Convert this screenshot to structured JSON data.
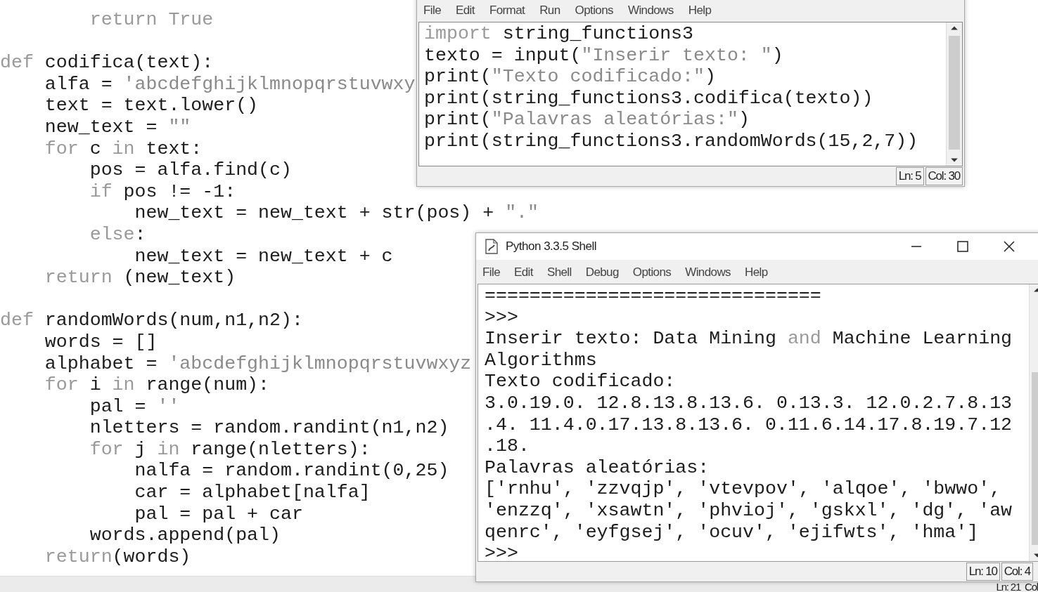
{
  "background_editor": {
    "functions": [
      {
        "lines": [
          [
            {
              "text": "        return True",
              "kind": "keyword"
            }
          ]
        ]
      },
      {
        "lines": [
          [
            {
              "text": "def",
              "kind": "keyword"
            },
            {
              "text": " codifica(text):",
              "kind": "plain"
            }
          ],
          [
            {
              "text": "    alfa = ",
              "kind": "plain"
            },
            {
              "text": "'abcdefghijklmnopqrstuvwxy",
              "kind": "string"
            }
          ],
          [
            {
              "text": "    text = text.lower()",
              "kind": "plain"
            }
          ],
          [
            {
              "text": "    new_text = ",
              "kind": "plain"
            },
            {
              "text": "\"\"",
              "kind": "string"
            }
          ],
          [
            {
              "text": "    for",
              "kind": "keyword"
            },
            {
              "text": " c ",
              "kind": "plain"
            },
            {
              "text": "in",
              "kind": "keyword"
            },
            {
              "text": " text:",
              "kind": "plain"
            }
          ],
          [
            {
              "text": "        pos = alfa.find(c)",
              "kind": "plain"
            }
          ],
          [
            {
              "text": "        if",
              "kind": "keyword"
            },
            {
              "text": " pos != -1:",
              "kind": "plain"
            }
          ],
          [
            {
              "text": "            new_text = new_text + str(pos) + ",
              "kind": "plain"
            },
            {
              "text": "\".\"",
              "kind": "string"
            }
          ],
          [
            {
              "text": "        else",
              "kind": "keyword"
            },
            {
              "text": ":",
              "kind": "plain"
            }
          ],
          [
            {
              "text": "            new_text = new_text + c",
              "kind": "plain"
            }
          ],
          [
            {
              "text": "    return",
              "kind": "keyword"
            },
            {
              "text": " (new_text)",
              "kind": "plain"
            }
          ]
        ]
      },
      {
        "lines": [
          [
            {
              "text": "def",
              "kind": "keyword"
            },
            {
              "text": " randomWords(num,n1,n2):",
              "kind": "plain"
            }
          ],
          [
            {
              "text": "    words = []",
              "kind": "plain"
            }
          ],
          [
            {
              "text": "    alphabet = ",
              "kind": "plain"
            },
            {
              "text": "'abcdefghijklmnopqrstuvwxyz",
              "kind": "string"
            }
          ],
          [
            {
              "text": "    for",
              "kind": "keyword"
            },
            {
              "text": " i ",
              "kind": "plain"
            },
            {
              "text": "in",
              "kind": "keyword"
            },
            {
              "text": " range(num):",
              "kind": "plain"
            }
          ],
          [
            {
              "text": "        pal = ",
              "kind": "plain"
            },
            {
              "text": "''",
              "kind": "string"
            }
          ],
          [
            {
              "text": "        nletters = random.randint(n1,n2)",
              "kind": "plain"
            }
          ],
          [
            {
              "text": "        for",
              "kind": "keyword"
            },
            {
              "text": " j ",
              "kind": "plain"
            },
            {
              "text": "in",
              "kind": "keyword"
            },
            {
              "text": " range(nletters):",
              "kind": "plain"
            }
          ],
          [
            {
              "text": "            nalfa = random.randint(0,25)",
              "kind": "plain"
            }
          ],
          [
            {
              "text": "            car = alphabet[nalfa]",
              "kind": "plain"
            }
          ],
          [
            {
              "text": "            pal = pal + car",
              "kind": "plain"
            }
          ],
          [
            {
              "text": "        words.append(pal)",
              "kind": "plain"
            }
          ],
          [
            {
              "text": "    return",
              "kind": "keyword"
            },
            {
              "text": "(words)",
              "kind": "plain"
            }
          ]
        ]
      }
    ],
    "status_bar": {
      "line": "Ln: 21",
      "column": "Col"
    }
  },
  "editor_window": {
    "menu": [
      "File",
      "Edit",
      "Format",
      "Run",
      "Options",
      "Windows",
      "Help"
    ],
    "lines": [
      [
        {
          "text": "import",
          "kind": "keyword"
        },
        {
          "text": " string_functions3",
          "kind": "plain"
        }
      ],
      [
        {
          "text": "texto = input(",
          "kind": "plain"
        },
        {
          "text": "\"Inserir texto: \"",
          "kind": "string"
        },
        {
          "text": ")",
          "kind": "plain"
        }
      ],
      [
        {
          "text": "print(",
          "kind": "plain"
        },
        {
          "text": "\"Texto codificado:\"",
          "kind": "string"
        },
        {
          "text": ")",
          "kind": "plain"
        }
      ],
      [
        {
          "text": "print(string_functions3.codifica(texto))",
          "kind": "plain"
        }
      ],
      [
        {
          "text": "print(",
          "kind": "plain"
        },
        {
          "text": "\"Palavras aleatórias:\"",
          "kind": "string"
        },
        {
          "text": ")",
          "kind": "plain"
        }
      ],
      [
        {
          "text": "print(string_functions3.randomWords(15,2,7))",
          "kind": "plain"
        }
      ]
    ],
    "status_bar": {
      "line": "Ln: 5",
      "column": "Col: 30"
    }
  },
  "shell_window": {
    "title": "Python 3.3.5 Shell",
    "menu": [
      "File",
      "Edit",
      "Shell",
      "Debug",
      "Options",
      "Windows",
      "Help"
    ],
    "lines": [
      [
        {
          "text": "==============================",
          "kind": "plain"
        }
      ],
      [
        {
          "text": ">>>",
          "kind": "plain"
        }
      ],
      [
        {
          "text": "Inserir texto: Data Mining ",
          "kind": "plain"
        },
        {
          "text": "and",
          "kind": "keyword"
        },
        {
          "text": " Machine Learning",
          "kind": "plain"
        }
      ],
      [
        {
          "text": "Algorithms",
          "kind": "plain"
        }
      ],
      [
        {
          "text": "Texto codificado:",
          "kind": "plain"
        }
      ],
      [
        {
          "text": "3.0.19.0. 12.8.13.8.13.6. 0.13.3. 12.0.2.7.8.13",
          "kind": "plain"
        }
      ],
      [
        {
          "text": ".4. 11.4.0.17.13.8.13.6. 0.11.6.14.17.8.19.7.12",
          "kind": "plain"
        }
      ],
      [
        {
          "text": ".18.",
          "kind": "plain"
        }
      ],
      [
        {
          "text": "Palavras aleatórias:",
          "kind": "plain"
        }
      ],
      [
        {
          "text": "['rnhu', 'zzvqjp', 'vtevpov', 'alqoe', 'bwwo',",
          "kind": "plain"
        }
      ],
      [
        {
          "text": "'enzzq', 'xsawtn', 'phvioj', 'gskxl', 'dg', 'aw",
          "kind": "plain"
        }
      ],
      [
        {
          "text": "qenrc', 'eyfgsej', 'ocuv', 'ejifwts', 'hma']",
          "kind": "plain"
        }
      ],
      [
        {
          "text": ">>>",
          "kind": "plain"
        }
      ]
    ],
    "status_bar": {
      "line": "Ln: 10",
      "column": "Col: 4"
    }
  }
}
